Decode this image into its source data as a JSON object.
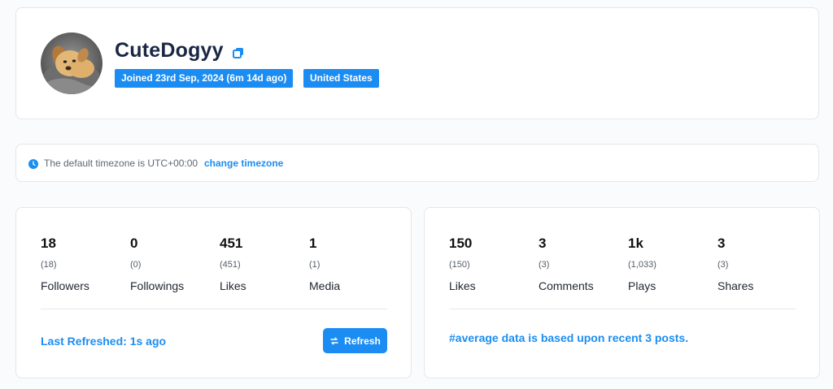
{
  "profile": {
    "username": "CuteDogyy",
    "joined_badge": "Joined 23rd Sep, 2024  (6m 14d ago)",
    "country_badge": "United States",
    "avatar_icon": "dog-avatar",
    "copy_icon": "copy-icon"
  },
  "timezone": {
    "text": "The default timezone is UTC+00:00",
    "link": "change timezone",
    "icon": "clock-icon"
  },
  "account_stats": [
    {
      "value": "18",
      "sub": "(18)",
      "label": "Followers"
    },
    {
      "value": "0",
      "sub": "(0)",
      "label": "Followings"
    },
    {
      "value": "451",
      "sub": "(451)",
      "label": "Likes"
    },
    {
      "value": "1",
      "sub": "(1)",
      "label": "Media"
    }
  ],
  "refresh": {
    "last_refreshed": "Last Refreshed: 1s ago",
    "button_label": "Refresh",
    "icon": "refresh-icon"
  },
  "average_stats": [
    {
      "value": "150",
      "sub": "(150)",
      "label": "Likes"
    },
    {
      "value": "3",
      "sub": "(3)",
      "label": "Comments"
    },
    {
      "value": "1k",
      "sub": "(1,033)",
      "label": "Plays"
    },
    {
      "value": "3",
      "sub": "(3)",
      "label": "Shares"
    }
  ],
  "average_note": "#average data is based upon recent 3 posts.",
  "colors": {
    "accent": "#1b8df2",
    "username": "#1a2744",
    "background": "#fafbfc"
  }
}
